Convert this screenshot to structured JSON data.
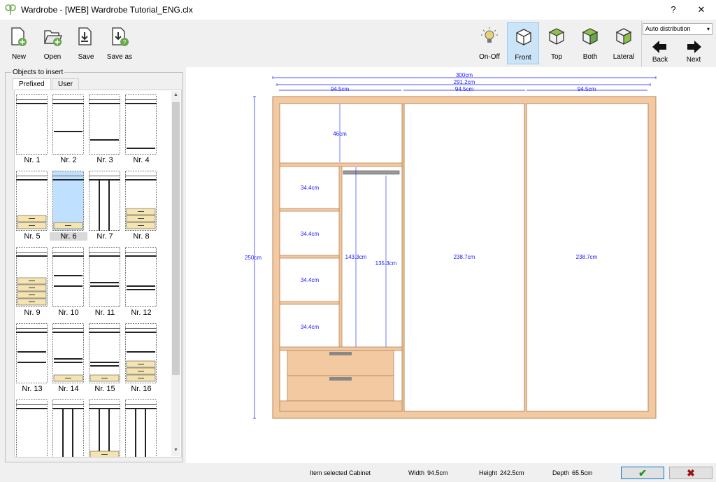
{
  "window": {
    "title": "Wardrobe - [WEB] Wardrobe Tutorial_ENG.clx",
    "help": "?",
    "close": "✕"
  },
  "toolbar": {
    "new_label": "New",
    "open_label": "Open",
    "save_label": "Save",
    "saveas_label": "Save as",
    "onoff_label": "On-Off",
    "front_label": "Front",
    "top_label": "Top",
    "both_label": "Both",
    "lateral_label": "Lateral",
    "back_label": "Back",
    "next_label": "Next",
    "distribution_value": "Auto distribution"
  },
  "left_panel": {
    "legend": "Objects to insert",
    "tabs": [
      "Prefixed",
      "User"
    ],
    "active_tab": "Prefixed",
    "items": [
      "Nr. 1",
      "Nr. 2",
      "Nr. 3",
      "Nr. 4",
      "Nr. 5",
      "Nr. 6",
      "Nr. 7",
      "Nr. 8",
      "Nr. 9",
      "Nr. 10",
      "Nr. 11",
      "Nr. 12",
      "Nr. 13",
      "Nr. 14",
      "Nr. 15",
      "Nr. 16",
      "",
      "",
      "",
      ""
    ],
    "selected_item": "Nr. 6"
  },
  "drawing": {
    "total_width": "300cm",
    "inner_width": "291.2cm",
    "module_widths": [
      "94.5cm",
      "94.5cm",
      "94.5cm"
    ],
    "height": "250cm",
    "top_shelf": "46cm",
    "compartments": [
      "34.4cm",
      "34.4cm",
      "34.4cm",
      "34.4cm"
    ],
    "hanging_outer": "143.3cm",
    "hanging_inner": "135.3cm",
    "module2_height": "238.7cm",
    "module3_height": "238.7cm"
  },
  "status": {
    "item_selected_label": "Item selected",
    "item_selected_value": "Cabinet",
    "width_label": "Width",
    "width_value": "94.5cm",
    "height_label": "Height",
    "height_value": "242.5cm",
    "depth_label": "Depth",
    "depth_value": "65.5cm",
    "ok": "✔",
    "cancel": "✖"
  },
  "colors": {
    "wood": "#f2c9a0",
    "wood_edge": "#b8865a",
    "dimension": "#1a1aff",
    "drawer_fill": "#f5e4b0",
    "selected_fill": "#bfe0ff"
  }
}
